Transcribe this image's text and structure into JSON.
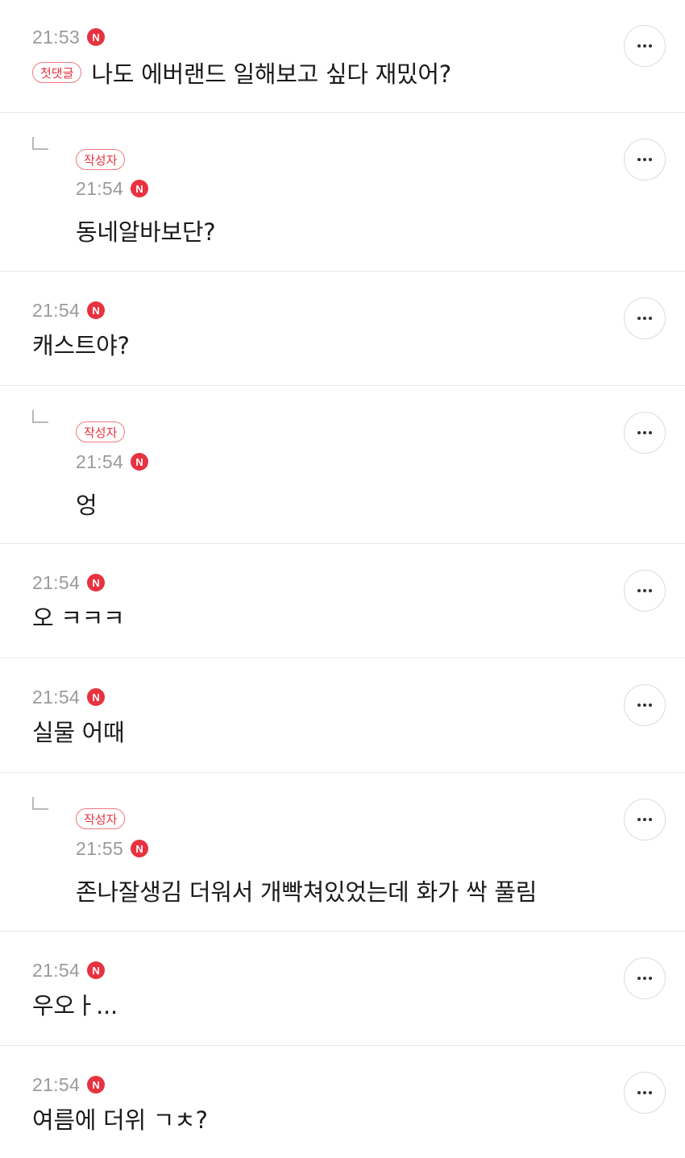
{
  "badges": {
    "new": "N",
    "first_comment": "첫댓글",
    "author": "작성자"
  },
  "colors": {
    "accent": "#e8323f",
    "time": "#9a9a9a",
    "divider": "#e9e9e9"
  },
  "icons": {
    "more": "more-icon",
    "reply": "reply-arrow-icon",
    "new": "new-badge-icon"
  },
  "comments": [
    {
      "time": "21:53",
      "text": "나도 에버랜드 일해보고 싶다 재밌어?",
      "is_reply": false,
      "first_comment": true
    },
    {
      "time": "21:54",
      "text": "동네알바보단?",
      "is_reply": true,
      "author": true
    },
    {
      "time": "21:54",
      "text": "캐스트야?",
      "is_reply": false
    },
    {
      "time": "21:54",
      "text": "엉",
      "is_reply": true,
      "author": true
    },
    {
      "time": "21:54",
      "text": "오 ㅋㅋㅋ",
      "is_reply": false
    },
    {
      "time": "21:54",
      "text": "실물 어때",
      "is_reply": false
    },
    {
      "time": "21:55",
      "text": "존나잘생김 더워서 개빡쳐있었는데 화가 싹 풀림",
      "is_reply": true,
      "author": true
    },
    {
      "time": "21:54",
      "text": "우오ㅏ...",
      "is_reply": false
    },
    {
      "time": "21:54",
      "text": "여름에 더위 ㄱㅊ?",
      "is_reply": false
    }
  ]
}
